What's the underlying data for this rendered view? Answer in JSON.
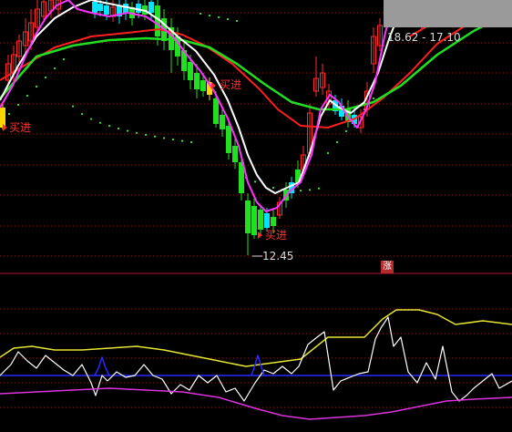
{
  "main_panel": {
    "buy_signal_label": "买进",
    "low_price_marker": "12.45",
    "range_readout": "18.62 - 17.10",
    "rise_badge": "涨"
  },
  "colors": {
    "background": "#000000",
    "grid": "#8b1a1a",
    "up_candle": "#ff2a2a",
    "down_candle": "#21e021",
    "flat_candle": "#00e5ff",
    "ma_white": "#ffffff",
    "ma_magenta": "#ff33ff",
    "ma_red": "#ff1f1f",
    "ma_green": "#22dd22",
    "dot_line": "#33ee33",
    "sub_yellow": "#e6e633",
    "sub_white": "#ffffff",
    "sub_blue": "#2a2aff",
    "sub_magenta": "#dd33dd",
    "divider": "#b3152a"
  }
}
